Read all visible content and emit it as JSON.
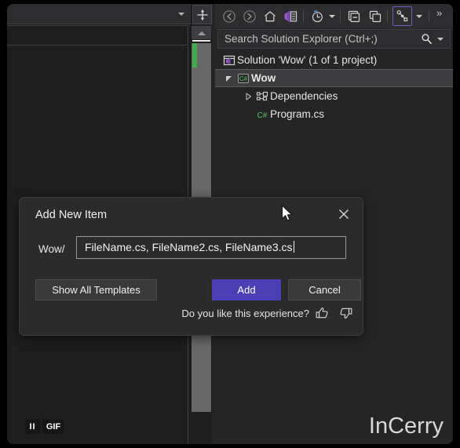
{
  "colors": {
    "window_bg": "#1e1e1e",
    "panel_bg": "#252526",
    "toolbar_bg": "#2d2d30",
    "dialog_bg": "#2b2b2b",
    "accent_primary": "#4b3fb5",
    "accent_highlight": "#6b5fc7",
    "csharp_green": "#3fae49",
    "vs_purple": "#9b4f96",
    "text": "#e6e6e6"
  },
  "editor": {
    "navbar_value": "",
    "navbar_icon": "chevron-down-icon",
    "split_icon": "split-window-icon",
    "scroll_up_icon": "scroll-up-arrow-icon",
    "change_marker": "unsaved-change-marker"
  },
  "solution_explorer": {
    "toolbar": [
      {
        "name": "back-button",
        "icon": "back-arrow-icon"
      },
      {
        "name": "forward-button",
        "icon": "forward-arrow-icon"
      },
      {
        "name": "home-button",
        "icon": "home-icon"
      },
      {
        "name": "solution-explorer-button",
        "icon": "visual-studio-solution-icon"
      },
      {
        "name": "pending-changes-button",
        "icon": "clock-history-icon"
      },
      {
        "name": "pending-changes-dropdown",
        "icon": "chevron-down-icon"
      },
      {
        "name": "collapse-all-button",
        "icon": "collapse-all-icon"
      },
      {
        "name": "show-all-files-button",
        "icon": "show-all-files-icon"
      },
      {
        "name": "filter-button",
        "icon": "code-map-filter-icon"
      },
      {
        "name": "filter-dropdown",
        "icon": "chevron-down-icon"
      },
      {
        "name": "toolbar-overflow-button",
        "icon": "overflow-chevrons-icon"
      }
    ],
    "search": {
      "placeholder": "Search Solution Explorer (Ctrl+;)",
      "icon": "search-icon",
      "dropdown_icon": "chevron-down-icon"
    },
    "tree": [
      {
        "label": "Solution 'Wow' (1 of 1 project)",
        "icon": "solution-icon",
        "indent": 8,
        "twisty": "none",
        "selected": false
      },
      {
        "label": "Wow",
        "icon": "csharp-project-icon",
        "indent": 12,
        "twisty": "expanded",
        "selected": true
      },
      {
        "label": "Dependencies",
        "icon": "dependencies-icon",
        "indent": 36,
        "twisty": "collapsed",
        "selected": false
      },
      {
        "label": "Program.cs",
        "icon": "csharp-file-icon",
        "indent": 52,
        "twisty": "none",
        "selected": false
      }
    ]
  },
  "dialog": {
    "title": "Add New Item",
    "close_icon": "close-icon",
    "path_prefix": "Wow/",
    "input_value": "FileName.cs, FileName2.cs, FileName3.cs",
    "buttons": {
      "show_all_templates": "Show All Templates",
      "add": "Add",
      "cancel": "Cancel"
    },
    "feedback_text": "Do you like this experience?",
    "thumbs_up_icon": "thumbs-up-icon",
    "thumbs_down_icon": "thumbs-down-icon"
  },
  "overlay": {
    "cursor_icon": "mouse-pointer-icon",
    "pause_label": "II",
    "gif_label": "GIF",
    "watermark": "InCerry"
  }
}
